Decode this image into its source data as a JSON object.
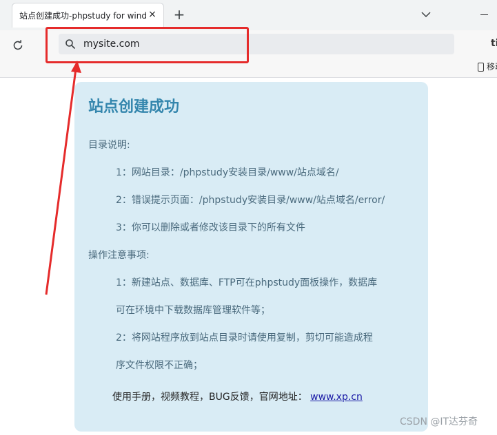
{
  "browser": {
    "tab_title": "站点创建成功-phpstudy for windows",
    "tab_close": "×",
    "new_tab": "+",
    "url": "mysite.com",
    "bookmark_label": "移动"
  },
  "page": {
    "heading": "站点创建成功",
    "dir_title": "目录说明:",
    "dir_items": [
      "1：网站目录：/phpstudy安装目录/www/站点域名/",
      "2：错误提示页面：/phpstudy安装目录/www/站点域名/error/",
      "3：你可以删除或者修改该目录下的所有文件"
    ],
    "ops_title": "操作注意事项:",
    "ops_lines": [
      "1：新建站点、数据库、FTP可在phpstudy面板操作，数据库",
      "可在环境中下载数据库管理软件等；",
      "2：将网站程序放到站点目录时请使用复制，剪切可能造成程",
      "序文件权限不正确；"
    ],
    "footer_text": "使用手册，视频教程，BUG反馈，官网地址：",
    "footer_link": "www.xp.cn"
  },
  "watermark": "CSDN @IT达芬奇",
  "colors": {
    "card_bg": "#d9ecf5",
    "heading": "#3486ad",
    "highlight": "#e52b2b"
  }
}
